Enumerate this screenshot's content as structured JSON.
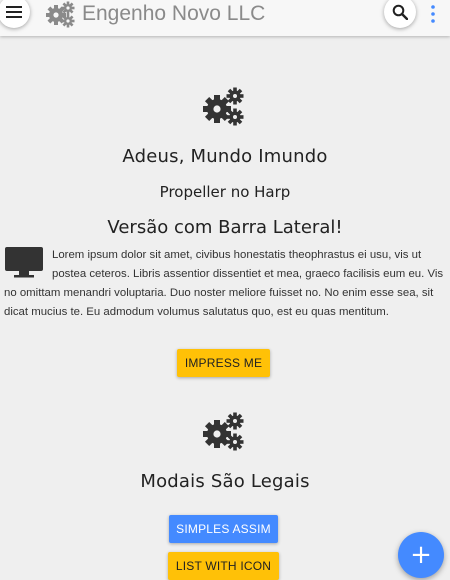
{
  "appbar": {
    "title": "Engenho Novo LLC",
    "menu_icon": "hamburger-menu-icon",
    "brand_icon": "gears-icon",
    "search_icon": "search-icon",
    "more_icon": "more-vertical-icon",
    "accent_color": "#448aff"
  },
  "section1": {
    "icon": "gears-icon",
    "title": "Adeus, Mundo Imundo",
    "subtitle": "Propeller no Harp",
    "heading": "Versão com Barra Lateral!",
    "paragraph_icon": "monitor-icon",
    "paragraph": "Lorem ipsum dolor sit amet, civibus honestatis theophrastus ei usu, vis ut postea ceteros. Libris assentior dissentiet et mea, graeco facilisis eum eu. Vis no omittam menandri voluptaria. Duo noster meliore fuisset no. No enim esse sea, sit dicat mucius te. Eu admodum volumus salutatus quo, est eu quas mentitum.",
    "button_label": "IMPRESS ME"
  },
  "section2": {
    "icon": "gears-icon",
    "title": "Modais São Legais",
    "button_primary": "SIMPLES ASSIM",
    "button_secondary": "LIST WITH ICON"
  },
  "fab": {
    "label": "+",
    "icon": "plus-icon"
  },
  "colors": {
    "amber": "#ffc107",
    "blue": "#448aff",
    "background": "#efefef"
  }
}
